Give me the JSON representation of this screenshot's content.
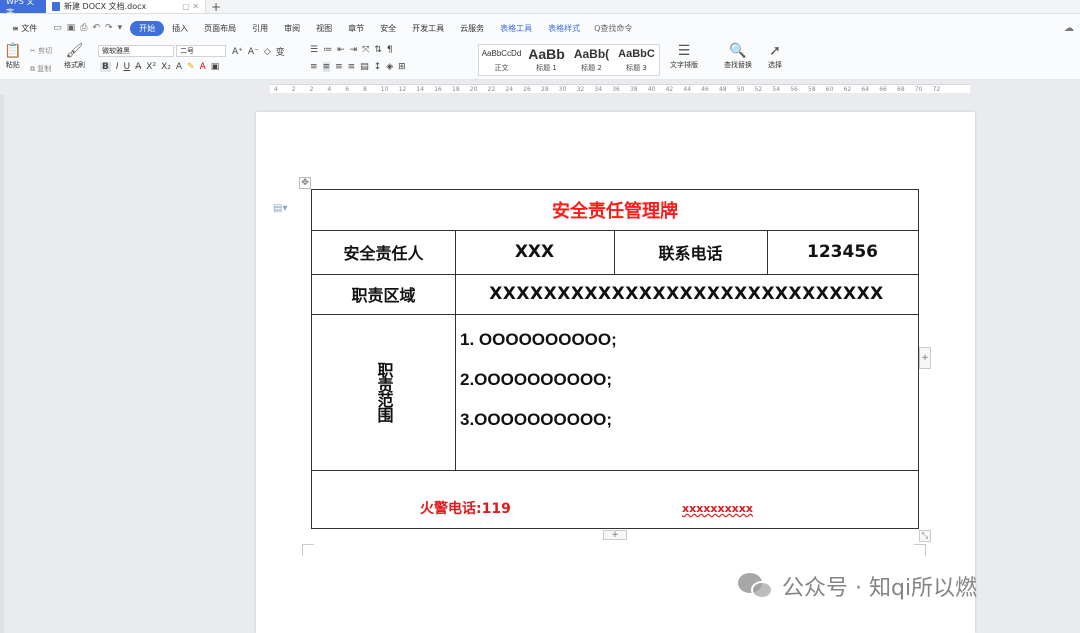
{
  "tabs": {
    "app": "WPS 文字",
    "doc": "新建 DOCX 文档.docx",
    "add": "+"
  },
  "menu": {
    "file": "≡ 文件",
    "items": [
      "开始",
      "插入",
      "页面布局",
      "引用",
      "审阅",
      "视图",
      "章节",
      "安全",
      "开发工具",
      "云服务",
      "表格工具",
      "表格样式"
    ],
    "search": "Q查找命令"
  },
  "ribbon": {
    "paste": "粘贴",
    "cut": "剪切",
    "copy": "复制",
    "format_painter": "格式刷",
    "font_name": "微软雅黑",
    "font_size": "二号",
    "styles": [
      {
        "sample": "AaBbCcDd",
        "name": "正文"
      },
      {
        "sample": "AaBb",
        "name": "标题 1"
      },
      {
        "sample": "AaBb(",
        "name": "标题 2"
      },
      {
        "sample": "AaBbC",
        "name": "标题 3"
      }
    ],
    "text_layout": "文字排版",
    "find_replace": "查找替换",
    "select": "选择"
  },
  "ruler": {
    "numbers": [
      "4",
      "2",
      "2",
      "4",
      "6",
      "8",
      "10",
      "12",
      "14",
      "16",
      "18",
      "20",
      "22",
      "24",
      "26",
      "28",
      "30",
      "32",
      "34",
      "36",
      "38",
      "40",
      "42",
      "44",
      "46",
      "48",
      "50",
      "52",
      "54",
      "56",
      "58",
      "60",
      "62",
      "64",
      "66",
      "68",
      "70",
      "72"
    ]
  },
  "document": {
    "table": {
      "title": "安全责任管理牌",
      "row1": {
        "label1": "安全责任人",
        "value1": "XXX",
        "label2": "联系电话",
        "value2": "123456"
      },
      "row2": {
        "label": "职责区域",
        "value": "XXXXXXXXXXXXXXXXXXXXXXXXXXXXX"
      },
      "row3": {
        "label": "职责范围",
        "items": [
          "1. OOOOOOOOOO;",
          "2.OOOOOOOOOO;",
          "3.OOOOOOOOOO;"
        ]
      },
      "footer": {
        "fire_label": "火警电话:119",
        "other": "xxxxxxxxxx"
      }
    }
  },
  "watermark": {
    "text": "公众号 · 知qi所以燃"
  },
  "colors": {
    "accent": "#3f6fd8",
    "title_red": "#ff1a1a"
  }
}
